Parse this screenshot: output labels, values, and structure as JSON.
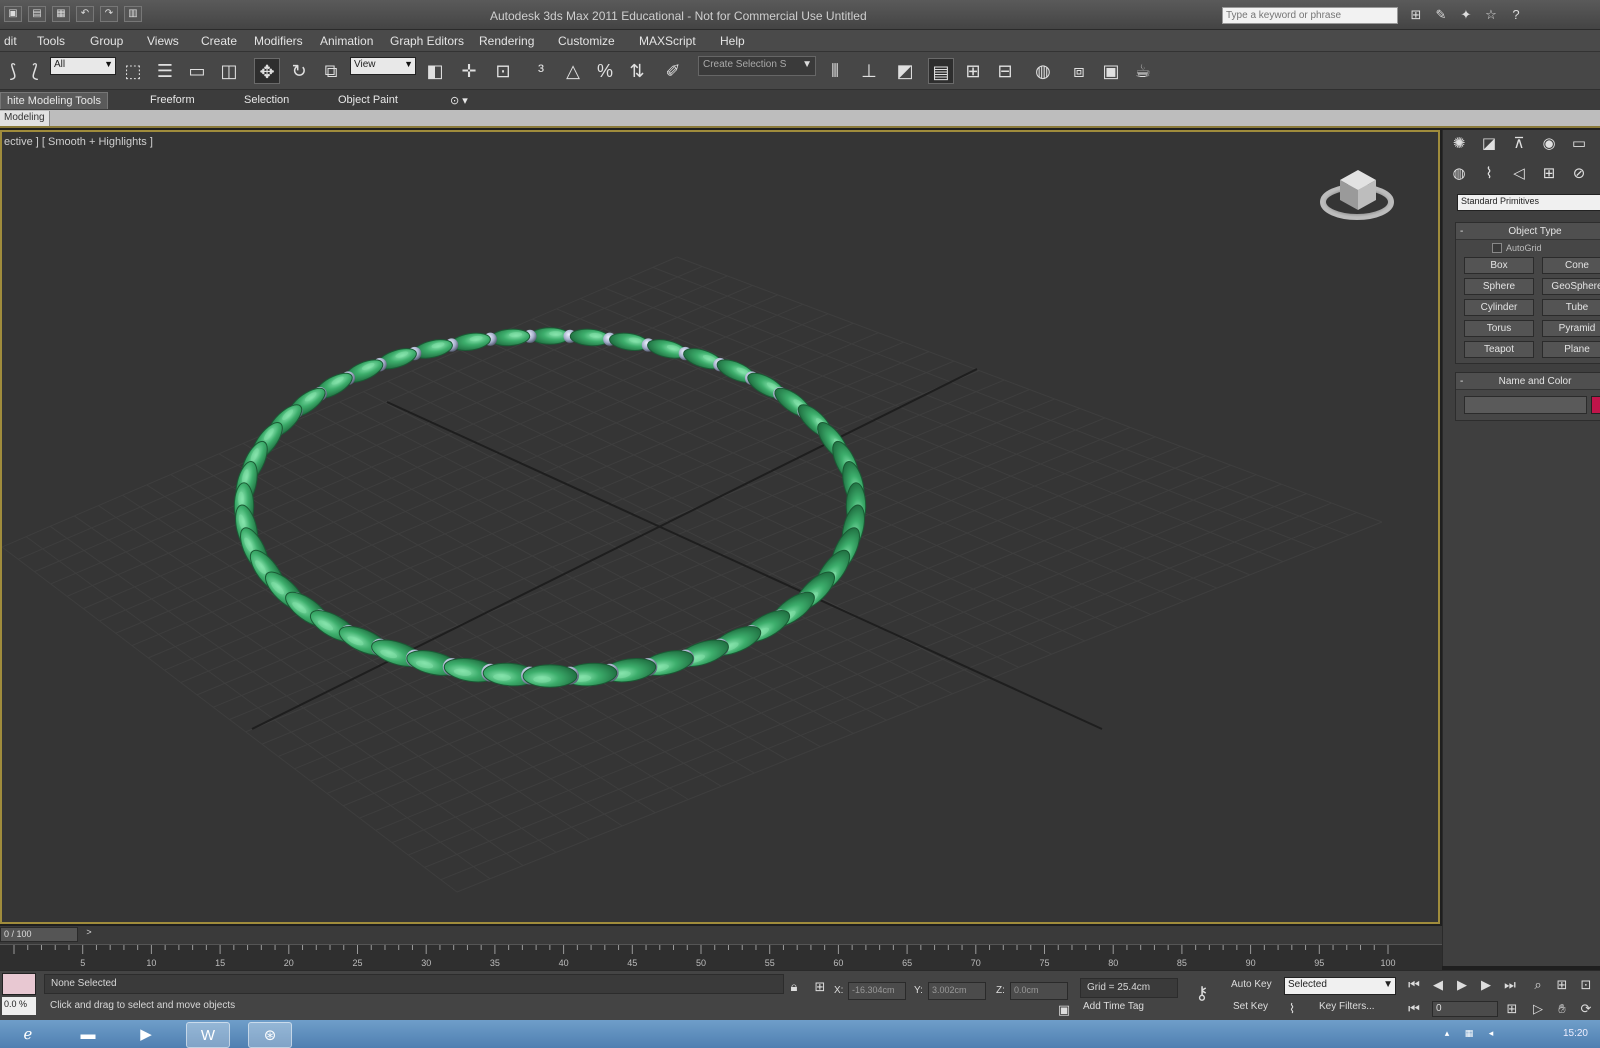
{
  "window": {
    "title": "Autodesk 3ds Max 2011   Educational - Not for Commercial Use    Untitled",
    "search_placeholder": "Type a keyword or phrase"
  },
  "menu": [
    "dit",
    "Tools",
    "Group",
    "Views",
    "Create",
    "Modifiers",
    "Animation",
    "Graph Editors",
    "Rendering",
    "Customize",
    "MAXScript",
    "Help"
  ],
  "toolbar": {
    "filter_value": "All",
    "reference_value": "View",
    "named_selection_placeholder": "Create Selection S"
  },
  "ribbon": {
    "tabs": [
      "hite Modeling Tools",
      "Freeform",
      "Selection",
      "Object Paint"
    ],
    "panel_label": "Modeling"
  },
  "viewport": {
    "label": "ective ] [ Smooth + Highlights ]",
    "colors": {
      "background": "#353535",
      "bead": "#3dae6c",
      "bead_highlight": "#7fe0a6",
      "ball": "#b8c2dc",
      "grid": "#3e3e3e",
      "axis": "#1e1e1e"
    },
    "ring_bead_count": 48
  },
  "command_panel": {
    "category": "Standard Primitives",
    "object_type": {
      "header": "Object Type",
      "autogrid_label": "AutoGrid",
      "buttons": [
        "Box",
        "Cone",
        "Sphere",
        "GeoSphere",
        "Cylinder",
        "Tube",
        "Torus",
        "Pyramid",
        "Teapot",
        "Plane"
      ]
    },
    "name_color": {
      "header": "Name and Color",
      "swatch": "#c0144a"
    }
  },
  "timeline": {
    "slider": "0 / 100",
    "ticks": [
      "5",
      "10",
      "15",
      "20",
      "25",
      "30",
      "35",
      "40",
      "45",
      "50",
      "55",
      "60",
      "65",
      "70",
      "75",
      "80",
      "85",
      "90",
      "95",
      "100"
    ]
  },
  "status": {
    "zoom": "0.0  %",
    "selection": "None Selected",
    "prompt": "Click and drag to select and move objects",
    "x_value": "-16.304cm",
    "y_value": "3.002cm",
    "z_value": "0.0cm",
    "grid": "Grid = 25.4cm",
    "add_time_tag": "Add Time Tag",
    "auto_key": "Auto Key",
    "set_key": "Set Key",
    "key_mode": "Selected",
    "key_filters": "Key Filters...",
    "frame": "0"
  },
  "taskbar": {
    "clock": "15:20"
  }
}
